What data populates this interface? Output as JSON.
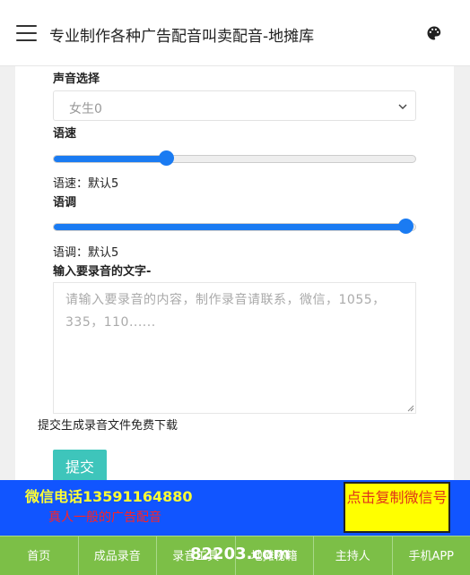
{
  "header": {
    "title": "专业制作各种广告配音叫卖配音-地摊库",
    "menu_icon": "hamburger-icon",
    "palette_icon": "palette-icon"
  },
  "form": {
    "voice_label": "声音选择",
    "voice_value": "女生0",
    "speed_label": "语速",
    "speed_status": "语速：默认5",
    "speed_value": 0.31,
    "pitch_label": "语调",
    "pitch_status": "语调：默认5",
    "pitch_value": 0.97,
    "text_label": "输入要录音的文字-",
    "text_placeholder": "请输入要录音的内容，制作录音请联系，微信，1055，335，110......",
    "note": "提交生成录音文件免费下载",
    "submit_label": "提交"
  },
  "banner": {
    "phone_label": "微信电话",
    "phone_number": "13591164880",
    "slogan": "真人一般的广告配音",
    "copy_button": "点击复制微信号"
  },
  "nav": {
    "items": [
      "首页",
      "成品录音",
      "录音工具",
      "地摊秘籍",
      "主持人",
      "手机APP"
    ]
  },
  "watermark": "82203.com",
  "colors": {
    "accent_blue": "#1a7bf2",
    "submit_teal": "#3ec5bb",
    "banner_blue": "#1155ff",
    "nav_green": "#7cbf47",
    "highlight_yellow": "#ffff00"
  }
}
